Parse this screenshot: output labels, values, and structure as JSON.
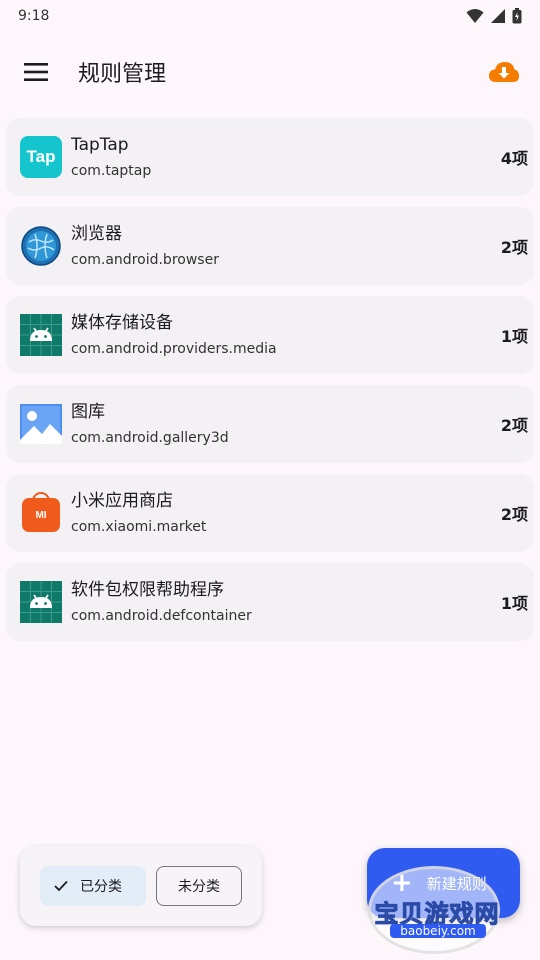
{
  "status_bar": {
    "time": "9:18"
  },
  "app_bar": {
    "title": "规则管理"
  },
  "apps": [
    {
      "name": "TapTap",
      "package": "com.taptap",
      "count": "4项",
      "icon": "taptap-icon",
      "icon_text": "Tap"
    },
    {
      "name": "浏览器",
      "package": "com.android.browser",
      "count": "2项",
      "icon": "globe-icon"
    },
    {
      "name": "媒体存储设备",
      "package": "com.android.providers.media",
      "count": "1项",
      "icon": "android-icon"
    },
    {
      "name": "图库",
      "package": "com.android.gallery3d",
      "count": "2项",
      "icon": "gallery-icon"
    },
    {
      "name": "小米应用商店",
      "package": "com.xiaomi.market",
      "count": "2项",
      "icon": "mi-store-icon",
      "icon_text": "MI"
    },
    {
      "name": "软件包权限帮助程序",
      "package": "com.android.defcontainer",
      "count": "1项",
      "icon": "android-icon"
    }
  ],
  "filters": {
    "selected": "已分类",
    "unselected": "未分类"
  },
  "fab": {
    "label": "新建规则"
  },
  "watermark": {
    "text": "宝贝游戏网",
    "url": "baobeiy.com"
  },
  "colors": {
    "accent": "#2f5bf0",
    "cloud": "#f57c00",
    "taptap": "#15c5ce",
    "android_bg": "#0f7a6a",
    "mi_orange": "#f05a1a"
  }
}
